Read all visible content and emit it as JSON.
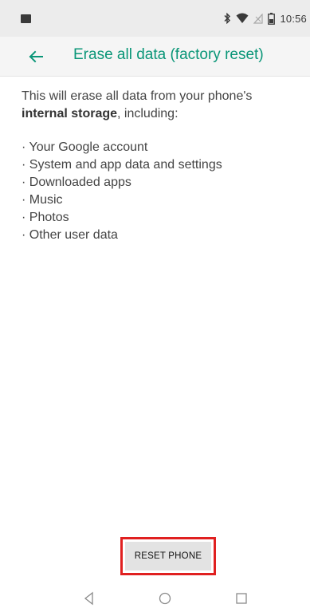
{
  "status_bar": {
    "time": "10:56",
    "icons": [
      "image-notification-icon",
      "bluetooth-icon",
      "wifi-icon",
      "no-signal-icon",
      "battery-icon"
    ]
  },
  "app_bar": {
    "title": "Erase all data (factory reset)",
    "accent_color": "#0a9678"
  },
  "content": {
    "intro_text": "This will erase all data from your phone's",
    "intro_strong": "internal storage",
    "intro_suffix": ", including:",
    "items": [
      "· Your Google account",
      "· System and app data and settings",
      "· Downloaded apps",
      "· Music",
      "· Photos",
      "· Other user data"
    ]
  },
  "action": {
    "reset_label": "RESET PHONE",
    "highlight_color": "#e02020"
  },
  "nav_bar": {
    "icons": [
      "back-triangle-icon",
      "home-circle-icon",
      "recents-square-icon"
    ]
  }
}
